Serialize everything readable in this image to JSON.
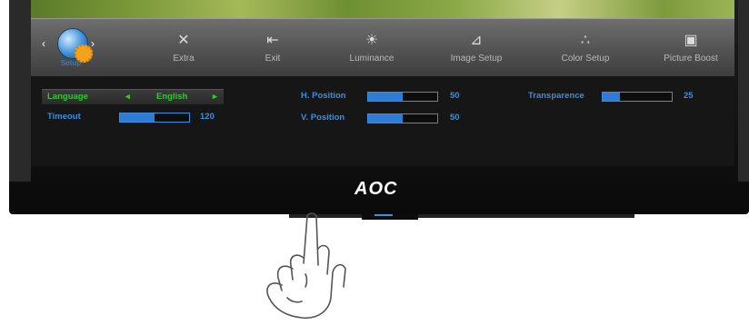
{
  "brand": "AOC",
  "menu": {
    "selected": {
      "label": "Setup"
    },
    "items": [
      {
        "label": "Extra",
        "icon": "tools-icon"
      },
      {
        "label": "Exit",
        "icon": "exit-icon"
      },
      {
        "label": "Luminance",
        "icon": "sun-icon"
      },
      {
        "label": "Image Setup",
        "icon": "image-setup-icon"
      },
      {
        "label": "Color Setup",
        "icon": "color-dots-icon"
      },
      {
        "label": "Picture Boost",
        "icon": "picture-boost-icon"
      }
    ]
  },
  "settings": {
    "language": {
      "label": "Language",
      "value": "English"
    },
    "timeout": {
      "label": "Timeout",
      "value": "120",
      "level": 0.5
    },
    "h_position": {
      "label": "H. Position",
      "value": "50",
      "level": 0.5
    },
    "v_position": {
      "label": "V. Position",
      "value": "50",
      "level": 0.5
    },
    "transparence": {
      "label": "Transparence",
      "value": "25",
      "level": 0.25
    }
  },
  "colors": {
    "accent": "#3a8fe0",
    "active": "#2ecc2e"
  }
}
